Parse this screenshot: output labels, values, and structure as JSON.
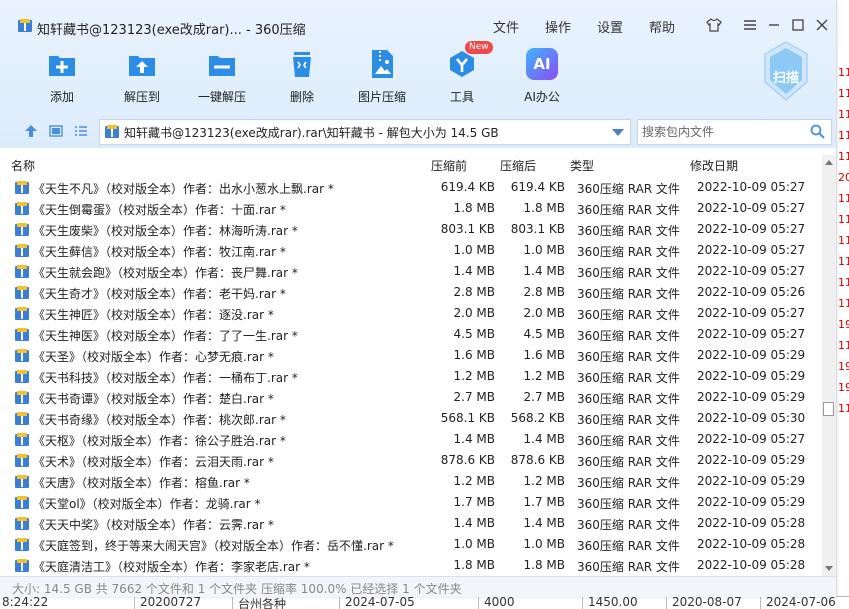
{
  "window": {
    "title": "知轩藏书@123123(exe改成rar)... - 360压缩",
    "menu": [
      "文件",
      "操作",
      "设置",
      "帮助"
    ]
  },
  "toolbar": {
    "tools": [
      {
        "label": "添加",
        "icon": "add-icon"
      },
      {
        "label": "解压到",
        "icon": "extract-to-icon"
      },
      {
        "label": "一键解压",
        "icon": "one-click-extract-icon"
      },
      {
        "label": "删除",
        "icon": "delete-icon"
      },
      {
        "label": "图片压缩",
        "icon": "image-compress-icon"
      },
      {
        "label": "工具",
        "icon": "tools-icon",
        "badge": "New"
      },
      {
        "label": "AI办公",
        "icon": "ai-office-icon",
        "icon_text": "AI"
      }
    ],
    "scan_label": "扫描"
  },
  "address": {
    "path": "知轩藏书@123123(exe改成rar).rar\\知轩藏书 - 解包大小为 14.5 GB",
    "search_placeholder": "搜索包内文件"
  },
  "columns": {
    "name": "名称",
    "compressed": "压缩前",
    "original": "压缩后",
    "type": "类型",
    "modified": "修改日期"
  },
  "files": [
    {
      "name": "《天生不凡》（校对版全本）作者：出水小葱水上飘.rar *",
      "before": "619.4 KB",
      "after": "619.4 KB",
      "type": "360压缩 RAR 文件",
      "date": "2022-10-09 05:27"
    },
    {
      "name": "《天生倒霉蛋》（校对版全本）作者：十面.rar *",
      "before": "1.8 MB",
      "after": "1.8 MB",
      "type": "360压缩 RAR 文件",
      "date": "2022-10-09 05:27"
    },
    {
      "name": "《天生废柴》（校对版全本）作者：林海听涛.rar *",
      "before": "803.1 KB",
      "after": "803.1 KB",
      "type": "360压缩 RAR 文件",
      "date": "2022-10-09 05:27"
    },
    {
      "name": "《天生藓信》（校对版全本）作者：牧江南.rar *",
      "before": "1.0 MB",
      "after": "1.0 MB",
      "type": "360压缩 RAR 文件",
      "date": "2022-10-09 05:27"
    },
    {
      "name": "《天生就会跑》（校对版全本）作者：丧尸舞.rar *",
      "before": "1.4 MB",
      "after": "1.4 MB",
      "type": "360压缩 RAR 文件",
      "date": "2022-10-09 05:27"
    },
    {
      "name": "《天生奇才》（校对版全本）作者：老干妈.rar *",
      "before": "2.8 MB",
      "after": "2.8 MB",
      "type": "360压缩 RAR 文件",
      "date": "2022-10-09 05:26"
    },
    {
      "name": "《天生神匠》（校对版全本）作者：逐没.rar *",
      "before": "2.0 MB",
      "after": "2.0 MB",
      "type": "360压缩 RAR 文件",
      "date": "2022-10-09 05:27"
    },
    {
      "name": "《天生神医》（校对版全本）作者：了了一生.rar *",
      "before": "4.5 MB",
      "after": "4.5 MB",
      "type": "360压缩 RAR 文件",
      "date": "2022-10-09 05:27"
    },
    {
      "name": "《天圣》（校对版全本）作者：心梦无痕.rar *",
      "before": "1.6 MB",
      "after": "1.6 MB",
      "type": "360压缩 RAR 文件",
      "date": "2022-10-09 05:29"
    },
    {
      "name": "《天书科技》（校对版全本）作者：一桶布丁.rar *",
      "before": "1.2 MB",
      "after": "1.2 MB",
      "type": "360压缩 RAR 文件",
      "date": "2022-10-09 05:29"
    },
    {
      "name": "《天书奇谭》（校对版全本）作者：楚白.rar *",
      "before": "2.7 MB",
      "after": "2.7 MB",
      "type": "360压缩 RAR 文件",
      "date": "2022-10-09 05:29"
    },
    {
      "name": "《天书奇缘》（校对版全本）作者：桃次郎.rar *",
      "before": "568.1 KB",
      "after": "568.2 KB",
      "type": "360压缩 RAR 文件",
      "date": "2022-10-09 05:30"
    },
    {
      "name": "《天枢》（校对版全本）作者：徐公子胜治.rar *",
      "before": "1.4 MB",
      "after": "1.4 MB",
      "type": "360压缩 RAR 文件",
      "date": "2022-10-09 05:27"
    },
    {
      "name": "《天术》（校对版全本）作者：云泪天雨.rar *",
      "before": "878.6 KB",
      "after": "878.6 KB",
      "type": "360压缩 RAR 文件",
      "date": "2022-10-09 05:29"
    },
    {
      "name": "《天唐》（校对版全本）作者：榕鱼.rar *",
      "before": "1.2 MB",
      "after": "1.2 MB",
      "type": "360压缩 RAR 文件",
      "date": "2022-10-09 05:29"
    },
    {
      "name": "《天堂ol》（校对版全本）作者：龙骑.rar *",
      "before": "1.7 MB",
      "after": "1.7 MB",
      "type": "360压缩 RAR 文件",
      "date": "2022-10-09 05:29"
    },
    {
      "name": "《天天中奖》（校对版全本）作者：云霁.rar *",
      "before": "1.4 MB",
      "after": "1.4 MB",
      "type": "360压缩 RAR 文件",
      "date": "2022-10-09 05:28"
    },
    {
      "name": "《天庭签到，终于等来大闹天宫》（校对版全本）作者：岳不懂.rar *",
      "before": "1.0 MB",
      "after": "1.0 MB",
      "type": "360压缩 RAR 文件",
      "date": "2022-10-09 05:28"
    },
    {
      "name": "《天庭清洁工》（校对版全本）作者：李家老店.rar *",
      "before": "1.8 MB",
      "after": "1.8 MB",
      "type": "360压缩 RAR 文件",
      "date": "2022-10-09 05:28"
    }
  ],
  "status": "大小: 14.5 GB 共 7662 个文件和 1 个文件夹 压缩率 100.0% 已经选择 1 个文件夹",
  "background": {
    "right_edge": [
      "11",
      "11",
      "11",
      "11",
      "11",
      "20",
      "11",
      "11",
      "11",
      "11",
      "11",
      "11",
      "19",
      "11",
      "19",
      "19",
      "11"
    ],
    "bottom_edge": [
      "8:24:22",
      "20200727",
      "台州各种",
      "2024-07-05",
      "4000",
      "1450.00",
      "2020-08-07",
      "2024-07-06"
    ]
  },
  "colors": {
    "toolbar_bg": "#dcebfb",
    "icon_blue": "#2b8de6",
    "new_badge": "#f04848",
    "ai_purple": "#7a5cf0",
    "size_text": "#222222"
  }
}
